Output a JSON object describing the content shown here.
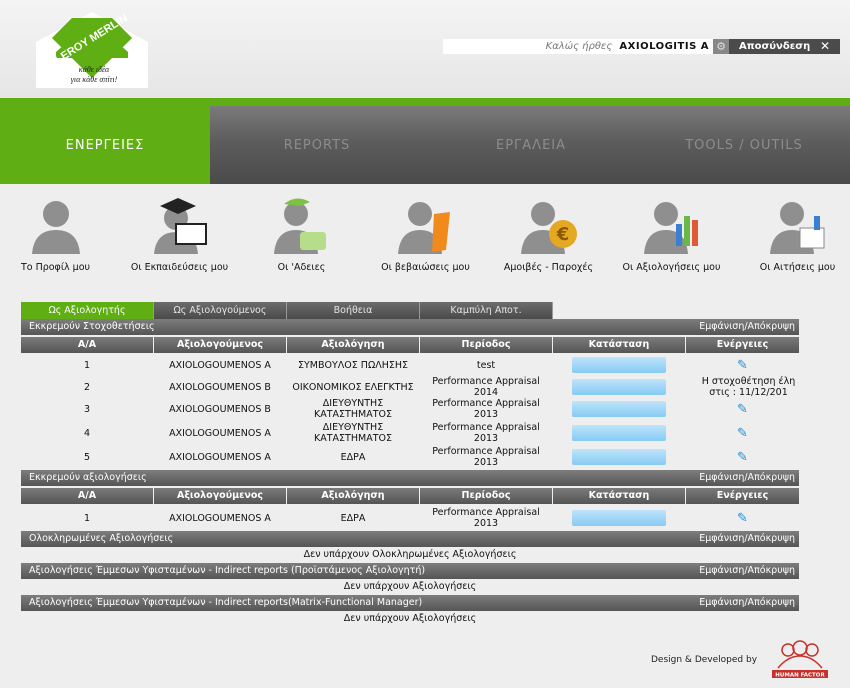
{
  "header": {
    "logo_text": "LEROY MERLIN",
    "logo_slogan": "κάθε ιδέα για κάθε σπίτι!",
    "welcome_label": "Καλώς ήρθες",
    "username": "AXIOLOGITIS A",
    "logout_label": "Αποσύνδεση",
    "close_glyph": "✕",
    "gear_glyph": "⚙"
  },
  "nav": {
    "tabs": [
      {
        "label": "ΕΝΕΡΓΕΙΕΣ",
        "active": true
      },
      {
        "label": "REPORTS",
        "active": false
      },
      {
        "label": "ΕΡΓΑΛΕΙΑ",
        "active": false
      },
      {
        "label": "TOOLS / OUTILS",
        "active": false
      }
    ]
  },
  "icons": [
    {
      "label": "Το Προφίλ μου",
      "icon": "profile-icon"
    },
    {
      "label": "Οι Εκπαιδεύσεις μου",
      "icon": "training-icon"
    },
    {
      "label": "Οι 'Αδειες",
      "icon": "leave-icon"
    },
    {
      "label": "Οι βεβαιώσεις μου",
      "icon": "certificate-icon"
    },
    {
      "label": "Αμοιβές - Παροχές",
      "icon": "payment-icon"
    },
    {
      "label": "Οι Αξιολογήσεις μου",
      "icon": "evaluation-icon"
    },
    {
      "label": "Οι Αιτήσεις μου",
      "icon": "request-icon"
    }
  ],
  "subtabs": [
    {
      "label": "Ως Αξιολογητής",
      "active": true
    },
    {
      "label": "Ως Αξιολογούμενος",
      "active": false
    },
    {
      "label": "Βοήθεια",
      "active": false
    },
    {
      "label": "Καμπύλη Αποτ.",
      "active": false
    }
  ],
  "toggle_label": "Εμφάνιση/Απόκρυψη",
  "columns": [
    "Α/Α",
    "Αξιολογούμενος",
    "Αξιολόγηση",
    "Περίοδος",
    "Κατάσταση",
    "Ενέργειες"
  ],
  "pending_goals": {
    "title": "Εκκρεμούν Στοχοθετήσεις",
    "rows": [
      {
        "num": "1",
        "name": "AXIOLOGOUMENOS A",
        "eval": "ΣΥΜΒΟΥΛΟΣ ΠΩΛΗΣΗΣ",
        "period": "test",
        "action": "✎"
      },
      {
        "num": "2",
        "name": "AXIOLOGOUMENOS B",
        "eval": "ΟΙΚΟΝΟΜΙΚΟΣ ΕΛΕΓΚΤΗΣ",
        "period": "Performance Appraisal 2014",
        "action": "Η στοχοθέτηση έλη στις : 11/12/201"
      },
      {
        "num": "3",
        "name": "AXIOLOGOUMENOS B",
        "eval": "ΔΙΕΥΘΥΝΤΗΣ ΚΑΤΑΣΤΗΜΑΤΟΣ",
        "period": "Performance Appraisal 2013",
        "action": "✎"
      },
      {
        "num": "4",
        "name": "AXIOLOGOUMENOS A",
        "eval": "ΔΙΕΥΘΥΝΤΗΣ ΚΑΤΑΣΤΗΜΑΤΟΣ",
        "period": "Performance Appraisal 2013",
        "action": "✎"
      },
      {
        "num": "5",
        "name": "AXIOLOGOUMENOS A",
        "eval": "ΕΔΡΑ",
        "period": "Performance Appraisal 2013",
        "action": "✎"
      }
    ]
  },
  "pending_evals": {
    "title": "Εκκρεμούν αξιολογήσεις",
    "rows": [
      {
        "num": "1",
        "name": "AXIOLOGOUMENOS A",
        "eval": "ΕΔΡΑ",
        "period": "Performance Appraisal 2013",
        "action": "✎"
      }
    ]
  },
  "completed": {
    "title": "Ολοκληρωμένες Αξιολογήσεις",
    "empty": "Δεν υπάρχουν Ολοκληρωμένες Αξιολογήσεις"
  },
  "indirect1": {
    "title": "Αξιολογήσεις Έμμεσων Υφισταμένων - Indirect reports (Προϊστάμενος Αξιολογητή)",
    "empty": "Δεν υπάρχουν Αξιολογήσεις"
  },
  "indirect2": {
    "title": "Αξιολογήσεις Έμμεσων Υφισταμένων - Indirect reports(Matrix-Functional Manager)",
    "empty": "Δεν υπάρχουν Αξιολογήσεις"
  },
  "footer": {
    "credit": "Design & Developed by",
    "brand": "HUMAN FACTOR"
  }
}
